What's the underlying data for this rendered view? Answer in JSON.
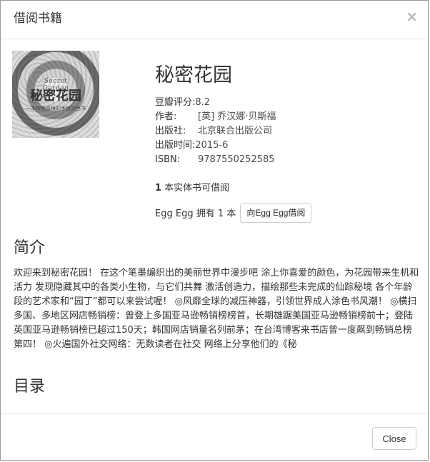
{
  "modal": {
    "title": "借阅书籍",
    "close_icon": "close-icon",
    "close_glyph": "×"
  },
  "book": {
    "cover_image_name": "book-cover",
    "cover_top_text": "Secret Garden",
    "cover_main_text": "秘密花园",
    "cover_sub_text": "一本探索奇境的手绘涂色书",
    "title": "秘密花园",
    "rating_label": "豆瓣评分:",
    "rating_value": "8.2",
    "author_label": "作者:",
    "author_value": "[英] 乔汉娜·贝斯福",
    "publisher_label": "出版社:",
    "publisher_value": "北京联合出版公司",
    "publish_date_label": "出版时间:",
    "publish_date_value": "2015-6",
    "isbn_label": "ISBN:",
    "isbn_value": "9787550252585"
  },
  "availability": {
    "count": "1",
    "text": " 本实体书可借阅"
  },
  "owner": {
    "text": "Egg Egg 拥有 1 本",
    "borrow_button_label": "向Egg Egg借阅"
  },
  "sections": {
    "intro_title": "简介",
    "intro_text": "欢迎来到秘密花园！ 在这个笔墨编织出的美丽世界中漫步吧 涂上你喜爱的颜色，为花园带来生机和活力 发现隐藏其中的各类小生物，与它们共舞 激活创造力，描绘那些未完成的仙踪秘境 各个年龄段的艺术家和“园丁”都可以来尝试喔！ ◎风靡全球的减压神器，引领世界成人涂色书风潮！ ◎横扫多国、多地区网店畅销榜：曾登上多国亚马逊畅销榜榜首，长期雄踞美国亚马逊畅销榜前十；登陆英国亚马逊畅销榜已超过150天；韩国网店销量名列前茅；在台湾博客来书店曾一度飙到畅销总榜第四！ ◎火遍国外社交网络：无数读者在社交 网络上分享他们的《秘",
    "toc_title": "目录"
  },
  "footer": {
    "close_label": "Close"
  },
  "colors": {
    "border": "#cccccc",
    "text": "#333333",
    "muted": "#b7b7b7",
    "divider": "#e5e5e5"
  }
}
